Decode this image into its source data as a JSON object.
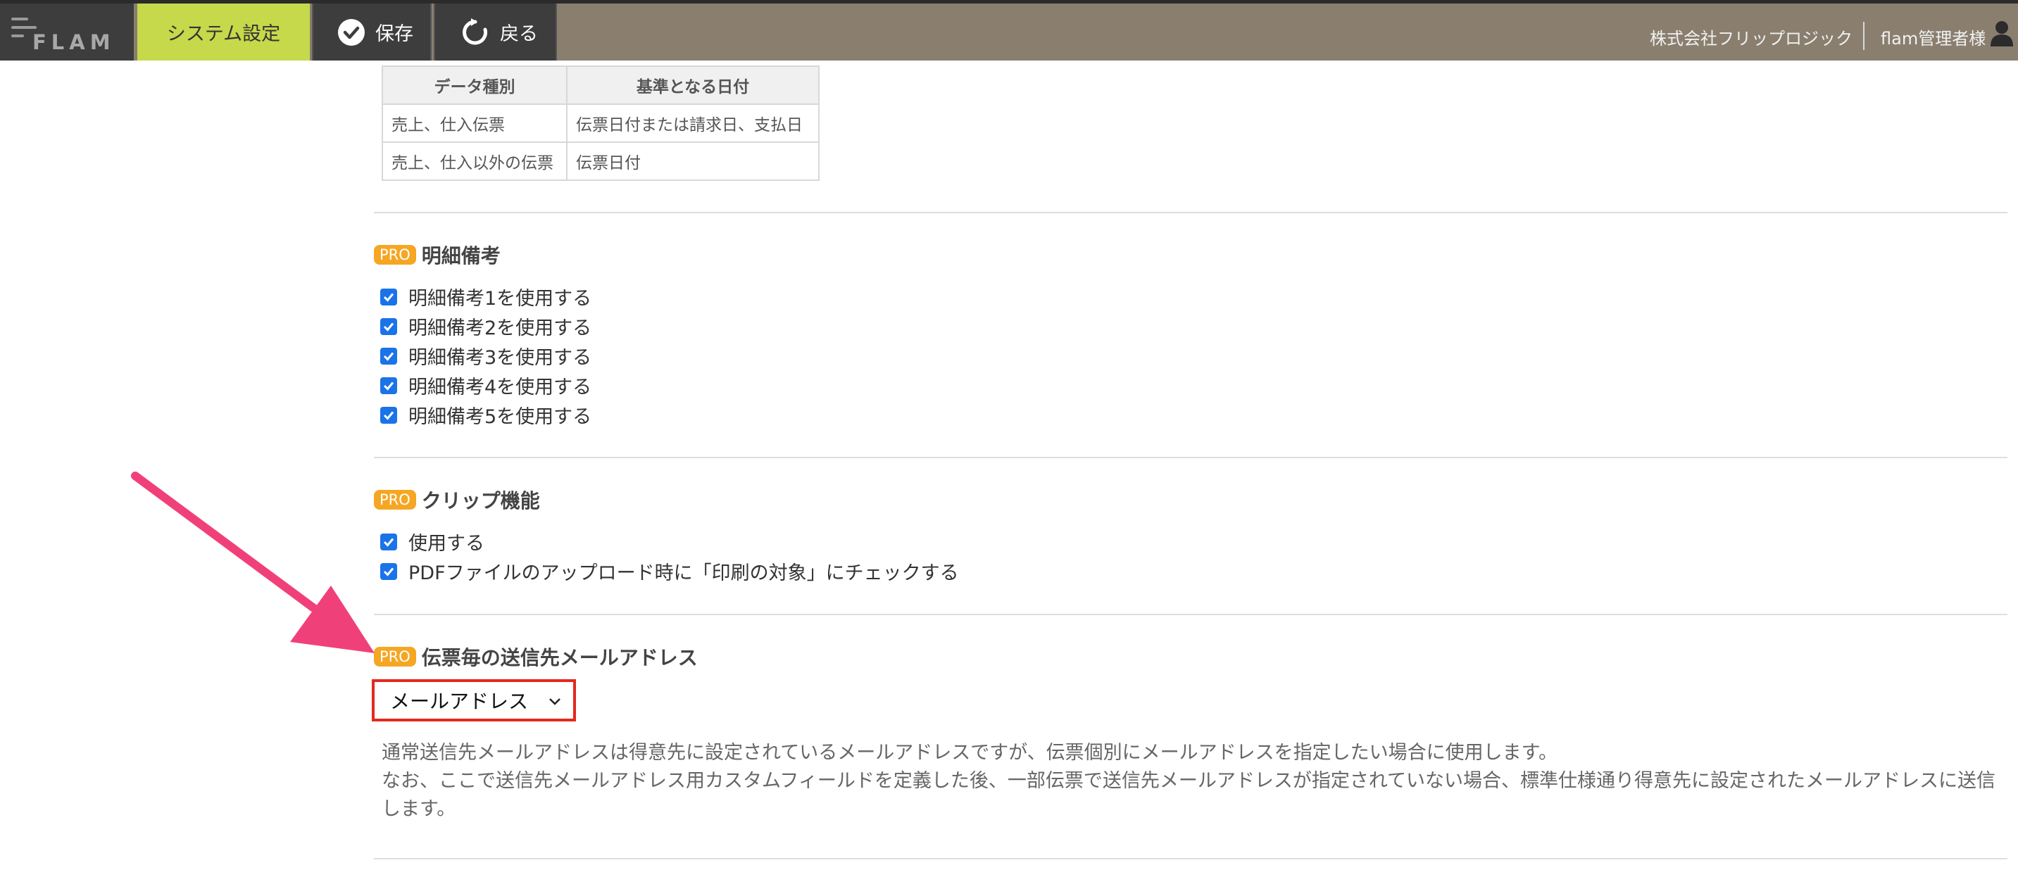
{
  "header": {
    "logo_text": "FLAM",
    "active_tab": "システム設定",
    "save_label": "保存",
    "back_label": "戻る",
    "company": "株式会社フリップロジック",
    "user": "flam管理者様"
  },
  "date_table": {
    "headers": [
      "データ種別",
      "基準となる日付"
    ],
    "rows": [
      [
        "売上、仕入伝票",
        "伝票日付または請求日、支払日"
      ],
      [
        "売上、仕入以外の伝票",
        "伝票日付"
      ]
    ]
  },
  "pro_badge": "PRO",
  "detail_notes": {
    "title": "明細備考",
    "options": [
      {
        "label": "明細備考1を使用する",
        "checked": true
      },
      {
        "label": "明細備考2を使用する",
        "checked": true
      },
      {
        "label": "明細備考3を使用する",
        "checked": true
      },
      {
        "label": "明細備考4を使用する",
        "checked": true
      },
      {
        "label": "明細備考5を使用する",
        "checked": true
      }
    ]
  },
  "clip": {
    "title": "クリップ機能",
    "options": [
      {
        "label": "使用する",
        "checked": true
      },
      {
        "label": "PDFファイルのアップロード時に「印刷の対象」にチェックする",
        "checked": true
      }
    ]
  },
  "email_section": {
    "title": "伝票毎の送信先メールアドレス",
    "select_value": "メールアドレス",
    "description_1": "通常送信先メールアドレスは得意先に設定されているメールアドレスですが、伝票個別にメールアドレスを指定したい場合に使用します。",
    "description_2": "なお、ここで送信先メールアドレス用カスタムフィールドを定義した後、一部伝票で送信先メールアドレスが指定されていない場合、標準仕様通り得意先に設定されたメールアドレスに送信します。"
  },
  "colors": {
    "topbar": "#8a7f6f",
    "active_tab": "#c5d94a",
    "pro_badge": "#f5a623",
    "checkbox": "#1a73e8",
    "highlight_border": "#e5281f",
    "annotation_arrow": "#f0407a"
  }
}
